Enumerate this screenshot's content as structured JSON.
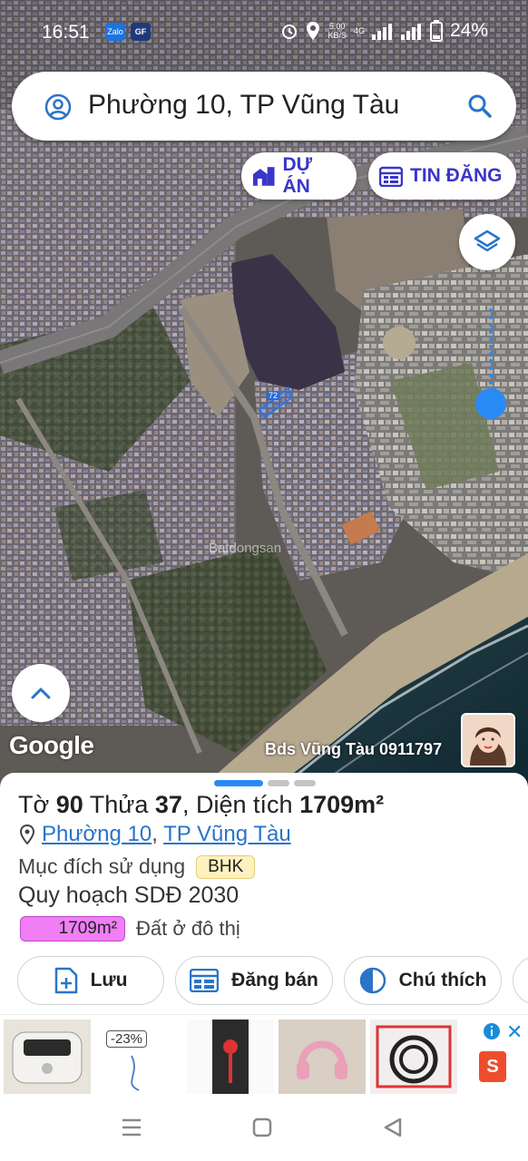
{
  "status_bar": {
    "time": "16:51",
    "app_badges": [
      "Zalo",
      "GF"
    ],
    "speed_value": "5.00",
    "speed_unit": "KB/S",
    "network": "4G",
    "battery": "24%"
  },
  "search": {
    "query": "Phường 10, TP Vũng Tàu"
  },
  "chips": {
    "du_an": "DỰ ÁN",
    "tin_dang": "TIN ĐĂNG"
  },
  "map": {
    "parcel_number": "72",
    "google_logo": "Google",
    "watermark": "Bds Vũng Tàu 0911797",
    "brand": "Batdongsan"
  },
  "parcel": {
    "title_to_label": "Tờ",
    "to_number": "90",
    "title_thua_label": "Thửa",
    "thua_number": "37",
    "title_area_label": "Diện tích",
    "area": "1709m²",
    "ward": "Phường 10",
    "city": "TP Vũng Tàu",
    "purpose_label": "Mục đích sử dụng",
    "purpose_code": "BHK",
    "plan_label": "Quy hoạch SDĐ 2030",
    "zone_area": "1709m²",
    "zone_name": "Đất ở đô thị",
    "zone_color": "#f07ef5"
  },
  "actions": {
    "save": "Lưu",
    "sell": "Đăng bán",
    "legend": "Chú thích"
  },
  "ad": {
    "discount": "-23%"
  },
  "colors": {
    "accent": "#2a8af5",
    "chip_text": "#3a36c8",
    "link": "#2a74c8"
  }
}
